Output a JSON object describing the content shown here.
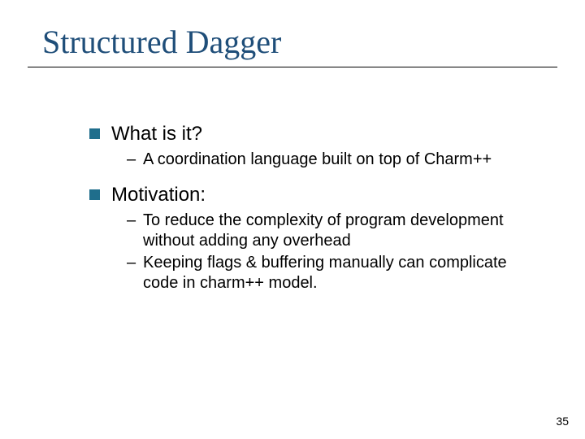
{
  "slide": {
    "title": "Structured Dagger",
    "page_number": "35",
    "bullets": [
      {
        "text": "What is it?",
        "sub": [
          "A coordination language built on top of Charm++"
        ]
      },
      {
        "text": "Motivation:",
        "sub": [
          "To reduce the complexity of program development without adding any overhead",
          "Keeping flags & buffering manually can complicate code in charm++ model."
        ]
      }
    ]
  }
}
